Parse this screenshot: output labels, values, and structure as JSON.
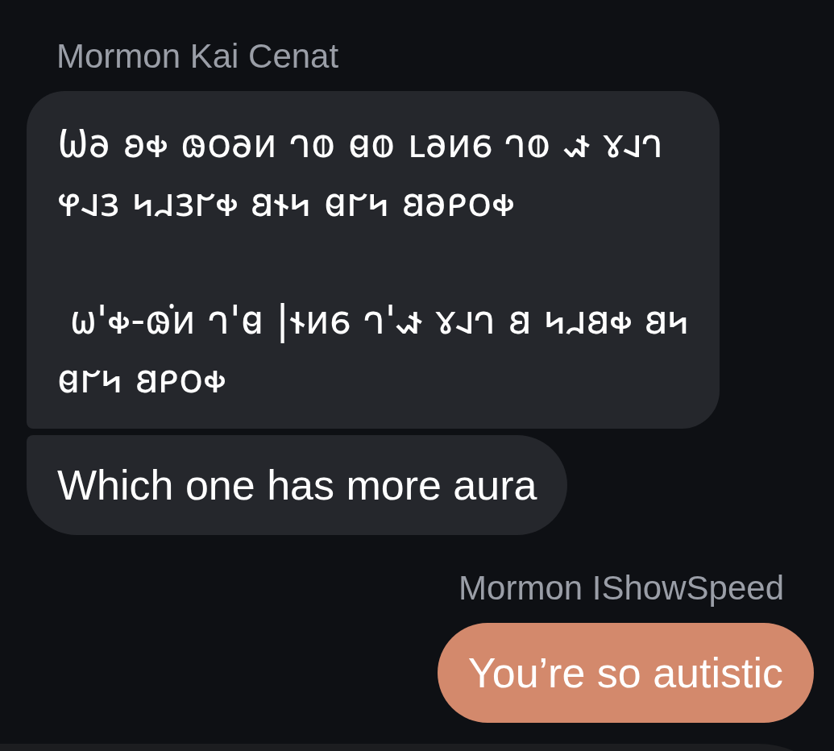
{
  "messages": [
    {
      "kind": "incoming",
      "sender": "Mormon Kai Cenat",
      "bubbles": [
        {
          "kind": "deseret",
          "text": "𐐎𐐨 𐐪𐑉 𐑀𐐬𐐨𐑍 𐐻𐐭 𐐼𐐭 𐑃𐐨𐑍𐑆 𐐻𐐭 𐑎 𐑄𐐰𐐻 𐐸𐐰𐑂 𐑌𐐯𐑂𐐲𐑉 𐐺𐐮𐑌 𐐼𐐲𐑌 𐐺𐐨𐑁𐐬𐑉\n\n 𐐶'𐑉-𐑀̇𐑍 𐐻'𐐼 |𐐮𐑍𐑆 𐐻'𐑎 𐑄𐐰𐐻 𐐺 𐑌𐐯𐐺𐑉 𐐺𐑌 𐐼𐐲𐑌 𐐺𐑁𐐬𐑉"
        },
        {
          "kind": "plain",
          "text": "Which one has more aura"
        }
      ]
    },
    {
      "kind": "outgoing",
      "sender": "Mormon IShowSpeed",
      "bubbles": [
        {
          "kind": "plain",
          "text": "You’re so autistic"
        }
      ]
    }
  ]
}
